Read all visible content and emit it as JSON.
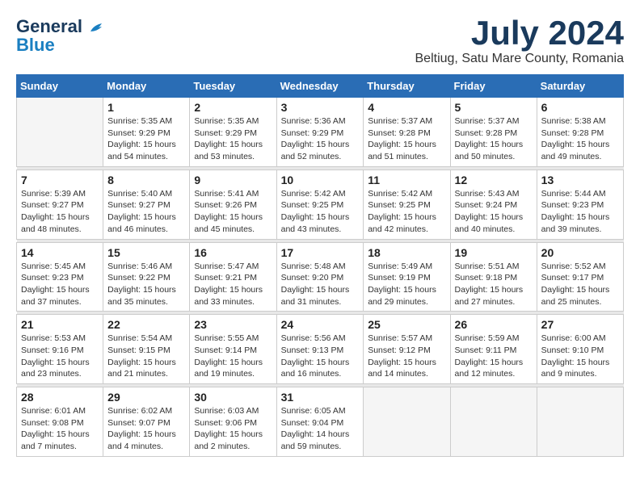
{
  "header": {
    "logo_line1": "General",
    "logo_line2": "Blue",
    "month_year": "July 2024",
    "location": "Beltiug, Satu Mare County, Romania"
  },
  "weekdays": [
    "Sunday",
    "Monday",
    "Tuesday",
    "Wednesday",
    "Thursday",
    "Friday",
    "Saturday"
  ],
  "weeks": [
    [
      {
        "day": "",
        "sunrise": "",
        "sunset": "",
        "daylight": ""
      },
      {
        "day": "1",
        "sunrise": "Sunrise: 5:35 AM",
        "sunset": "Sunset: 9:29 PM",
        "daylight": "Daylight: 15 hours and 54 minutes."
      },
      {
        "day": "2",
        "sunrise": "Sunrise: 5:35 AM",
        "sunset": "Sunset: 9:29 PM",
        "daylight": "Daylight: 15 hours and 53 minutes."
      },
      {
        "day": "3",
        "sunrise": "Sunrise: 5:36 AM",
        "sunset": "Sunset: 9:29 PM",
        "daylight": "Daylight: 15 hours and 52 minutes."
      },
      {
        "day": "4",
        "sunrise": "Sunrise: 5:37 AM",
        "sunset": "Sunset: 9:28 PM",
        "daylight": "Daylight: 15 hours and 51 minutes."
      },
      {
        "day": "5",
        "sunrise": "Sunrise: 5:37 AM",
        "sunset": "Sunset: 9:28 PM",
        "daylight": "Daylight: 15 hours and 50 minutes."
      },
      {
        "day": "6",
        "sunrise": "Sunrise: 5:38 AM",
        "sunset": "Sunset: 9:28 PM",
        "daylight": "Daylight: 15 hours and 49 minutes."
      }
    ],
    [
      {
        "day": "7",
        "sunrise": "Sunrise: 5:39 AM",
        "sunset": "Sunset: 9:27 PM",
        "daylight": "Daylight: 15 hours and 48 minutes."
      },
      {
        "day": "8",
        "sunrise": "Sunrise: 5:40 AM",
        "sunset": "Sunset: 9:27 PM",
        "daylight": "Daylight: 15 hours and 46 minutes."
      },
      {
        "day": "9",
        "sunrise": "Sunrise: 5:41 AM",
        "sunset": "Sunset: 9:26 PM",
        "daylight": "Daylight: 15 hours and 45 minutes."
      },
      {
        "day": "10",
        "sunrise": "Sunrise: 5:42 AM",
        "sunset": "Sunset: 9:25 PM",
        "daylight": "Daylight: 15 hours and 43 minutes."
      },
      {
        "day": "11",
        "sunrise": "Sunrise: 5:42 AM",
        "sunset": "Sunset: 9:25 PM",
        "daylight": "Daylight: 15 hours and 42 minutes."
      },
      {
        "day": "12",
        "sunrise": "Sunrise: 5:43 AM",
        "sunset": "Sunset: 9:24 PM",
        "daylight": "Daylight: 15 hours and 40 minutes."
      },
      {
        "day": "13",
        "sunrise": "Sunrise: 5:44 AM",
        "sunset": "Sunset: 9:23 PM",
        "daylight": "Daylight: 15 hours and 39 minutes."
      }
    ],
    [
      {
        "day": "14",
        "sunrise": "Sunrise: 5:45 AM",
        "sunset": "Sunset: 9:23 PM",
        "daylight": "Daylight: 15 hours and 37 minutes."
      },
      {
        "day": "15",
        "sunrise": "Sunrise: 5:46 AM",
        "sunset": "Sunset: 9:22 PM",
        "daylight": "Daylight: 15 hours and 35 minutes."
      },
      {
        "day": "16",
        "sunrise": "Sunrise: 5:47 AM",
        "sunset": "Sunset: 9:21 PM",
        "daylight": "Daylight: 15 hours and 33 minutes."
      },
      {
        "day": "17",
        "sunrise": "Sunrise: 5:48 AM",
        "sunset": "Sunset: 9:20 PM",
        "daylight": "Daylight: 15 hours and 31 minutes."
      },
      {
        "day": "18",
        "sunrise": "Sunrise: 5:49 AM",
        "sunset": "Sunset: 9:19 PM",
        "daylight": "Daylight: 15 hours and 29 minutes."
      },
      {
        "day": "19",
        "sunrise": "Sunrise: 5:51 AM",
        "sunset": "Sunset: 9:18 PM",
        "daylight": "Daylight: 15 hours and 27 minutes."
      },
      {
        "day": "20",
        "sunrise": "Sunrise: 5:52 AM",
        "sunset": "Sunset: 9:17 PM",
        "daylight": "Daylight: 15 hours and 25 minutes."
      }
    ],
    [
      {
        "day": "21",
        "sunrise": "Sunrise: 5:53 AM",
        "sunset": "Sunset: 9:16 PM",
        "daylight": "Daylight: 15 hours and 23 minutes."
      },
      {
        "day": "22",
        "sunrise": "Sunrise: 5:54 AM",
        "sunset": "Sunset: 9:15 PM",
        "daylight": "Daylight: 15 hours and 21 minutes."
      },
      {
        "day": "23",
        "sunrise": "Sunrise: 5:55 AM",
        "sunset": "Sunset: 9:14 PM",
        "daylight": "Daylight: 15 hours and 19 minutes."
      },
      {
        "day": "24",
        "sunrise": "Sunrise: 5:56 AM",
        "sunset": "Sunset: 9:13 PM",
        "daylight": "Daylight: 15 hours and 16 minutes."
      },
      {
        "day": "25",
        "sunrise": "Sunrise: 5:57 AM",
        "sunset": "Sunset: 9:12 PM",
        "daylight": "Daylight: 15 hours and 14 minutes."
      },
      {
        "day": "26",
        "sunrise": "Sunrise: 5:59 AM",
        "sunset": "Sunset: 9:11 PM",
        "daylight": "Daylight: 15 hours and 12 minutes."
      },
      {
        "day": "27",
        "sunrise": "Sunrise: 6:00 AM",
        "sunset": "Sunset: 9:10 PM",
        "daylight": "Daylight: 15 hours and 9 minutes."
      }
    ],
    [
      {
        "day": "28",
        "sunrise": "Sunrise: 6:01 AM",
        "sunset": "Sunset: 9:08 PM",
        "daylight": "Daylight: 15 hours and 7 minutes."
      },
      {
        "day": "29",
        "sunrise": "Sunrise: 6:02 AM",
        "sunset": "Sunset: 9:07 PM",
        "daylight": "Daylight: 15 hours and 4 minutes."
      },
      {
        "day": "30",
        "sunrise": "Sunrise: 6:03 AM",
        "sunset": "Sunset: 9:06 PM",
        "daylight": "Daylight: 15 hours and 2 minutes."
      },
      {
        "day": "31",
        "sunrise": "Sunrise: 6:05 AM",
        "sunset": "Sunset: 9:04 PM",
        "daylight": "Daylight: 14 hours and 59 minutes."
      },
      {
        "day": "",
        "sunrise": "",
        "sunset": "",
        "daylight": ""
      },
      {
        "day": "",
        "sunrise": "",
        "sunset": "",
        "daylight": ""
      },
      {
        "day": "",
        "sunrise": "",
        "sunset": "",
        "daylight": ""
      }
    ]
  ]
}
